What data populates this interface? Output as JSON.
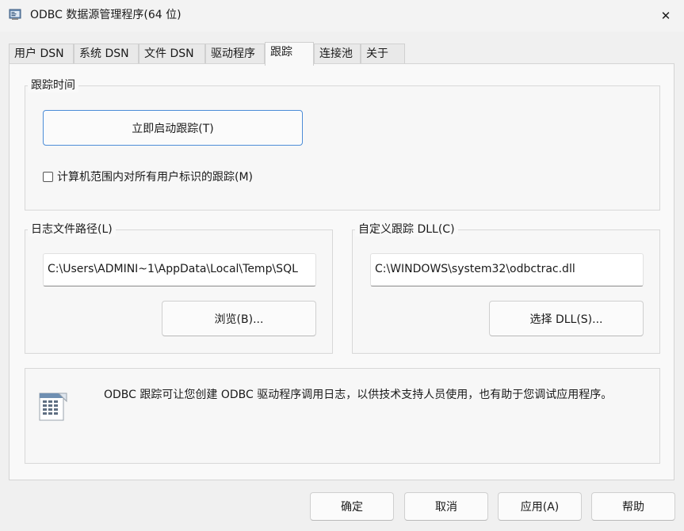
{
  "window": {
    "title": "ODBC 数据源管理程序(64 位)",
    "icon": "odbc-admin-icon",
    "close_glyph": "✕"
  },
  "tabs": [
    {
      "label": "用户 DSN",
      "active": false
    },
    {
      "label": "系统 DSN",
      "active": false
    },
    {
      "label": "文件 DSN",
      "active": false
    },
    {
      "label": "驱动程序",
      "active": false
    },
    {
      "label": "跟踪",
      "active": true
    },
    {
      "label": "连接池",
      "active": false
    },
    {
      "label": "关于",
      "active": false
    }
  ],
  "tracing": {
    "group_label": "跟踪时间",
    "start_button": "立即启动跟踪(T)",
    "machine_wide_checkbox": {
      "label": "计算机范围内对所有用户标识的跟踪(M)",
      "checked": false
    }
  },
  "log_path": {
    "group_label": "日志文件路径(L)",
    "value": "C:\\Users\\ADMINI~1\\AppData\\Local\\Temp\\SQL",
    "browse_button": "浏览(B)..."
  },
  "custom_dll": {
    "group_label": "自定义跟踪 DLL(C)",
    "value": "C:\\WINDOWS\\system32\\odbctrac.dll",
    "select_button": "选择 DLL(S)..."
  },
  "info": {
    "icon": "log-document-icon",
    "text": "ODBC 跟踪可让您创建 ODBC 驱动程序调用日志，以供技术支持人员使用，也有助于您调试应用程序。"
  },
  "footer": {
    "ok": "确定",
    "cancel": "取消",
    "apply": "应用(A)",
    "help": "帮助"
  },
  "colors": {
    "accent": "#4a8bd6",
    "window_bg": "#f0f0f0"
  }
}
